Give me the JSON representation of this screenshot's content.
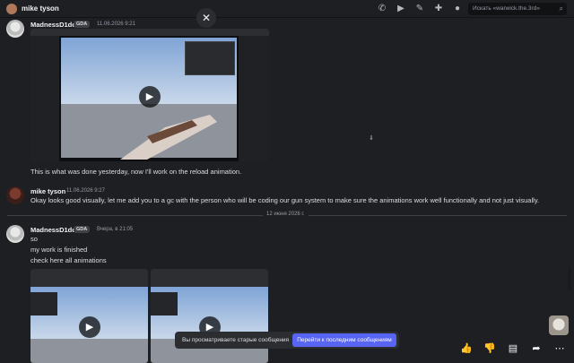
{
  "header": {
    "title": "mike tyson",
    "search_placeholder": "Искать «warwick.the.3rd»",
    "icons": [
      "phone-icon",
      "video-call-icon",
      "pin-icon",
      "add-member-icon",
      "profile-icon"
    ]
  },
  "messages": [
    {
      "author": "MadnessD1de",
      "tag": "GDA",
      "time": "11.06.2026 9:21",
      "lines": [
        "This is what was done yesterday, now I'll work on the reload animation."
      ]
    },
    {
      "author": "mike tyson",
      "time": "11.06.2026 9:27",
      "lines": [
        "Okay looks good visually, let me add you to a gc with the person who will be coding our gun system to make sure the animations work well functionally and not just visually."
      ]
    },
    {
      "author": "MadnessD1de",
      "tag": "GDA",
      "time": "Вчера, в 21:05",
      "lines": [
        "so",
        "my work is finished",
        "check here all animations"
      ]
    }
  ],
  "date_divider": "12 июня 2026 г.",
  "toast": {
    "text": "Вы просматриваете старые сообщения",
    "button": "Перейти к последним сообщениям"
  },
  "actions": [
    "thumbs-up-icon",
    "thumbs-down-icon",
    "reply-icon",
    "forward-icon",
    "more-icon"
  ],
  "colors": {
    "accent": "#5865f2",
    "background": "#1e1f22"
  }
}
